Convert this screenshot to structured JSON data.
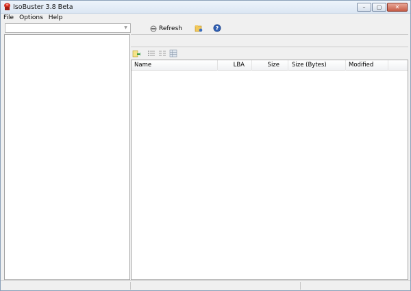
{
  "window": {
    "title": "IsoBuster 3.8 Beta",
    "caption_buttons": [
      "–",
      "▢",
      "✕"
    ]
  },
  "menu": {
    "items": [
      "File",
      "Options",
      "Help"
    ]
  },
  "toolbar": {
    "device_combo_value": "",
    "refresh_label": "Refresh",
    "icons": [
      "refresh-icon",
      "folder-icon",
      "help-icon"
    ]
  },
  "file_list": {
    "columns": [
      "Name",
      "LBA",
      "Size",
      "Size (Bytes)",
      "Modified"
    ],
    "rows": []
  },
  "right_toolbar": {
    "icons": [
      "extract-icon",
      "list-view-icon",
      "details-view-icon",
      "grid-view-icon"
    ]
  },
  "colors": {
    "accent": "#3a6fc4",
    "window_bg": "#f0f0f0"
  }
}
